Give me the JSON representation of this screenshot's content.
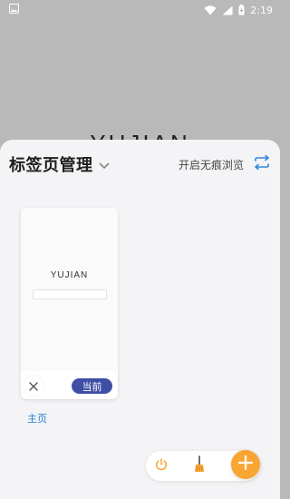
{
  "status_bar": {
    "time": "2:19",
    "icons": [
      "image-icon",
      "wifi-icon",
      "signal-icon",
      "battery-charging-icon"
    ]
  },
  "background": {
    "logo_text": "YUJIAN"
  },
  "sheet": {
    "title": "标签页管理",
    "incognito_label": "开启无痕浏览",
    "icons": [
      "chevron-down-icon",
      "switch-icon"
    ]
  },
  "tabs": [
    {
      "thumbnail_logo": "YUJIAN",
      "badge": "当前",
      "label": "主页"
    }
  ],
  "actions": {
    "icons": [
      "power-icon",
      "broom-icon",
      "add-icon"
    ]
  },
  "colors": {
    "accent_orange": "#f8a532",
    "badge_blue": "#3f4fa5",
    "link_blue": "#1e7fd6",
    "sheet_bg": "#f4f4f6",
    "page_bg": "#b9b9b9"
  }
}
